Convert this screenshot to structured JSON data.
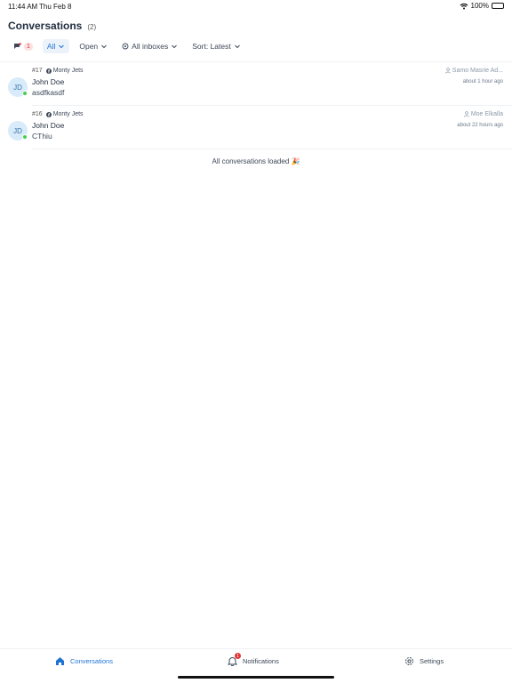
{
  "status_bar": {
    "time": "11:44 AM",
    "date": "Thu Feb 8",
    "battery": "100%"
  },
  "header": {
    "title": "Conversations",
    "count": "(2)"
  },
  "filters": {
    "unread_count": "1",
    "status_filter": "All",
    "conversation_status": "Open",
    "inbox_filter": "All inboxes",
    "sort": "Sort: Latest"
  },
  "conversations": [
    {
      "id": "#17",
      "inbox": "Monty Jets",
      "avatar_initials": "JD",
      "name": "John Doe",
      "message": "asdfkasdf",
      "assignee": "Samo Masrie Ad...",
      "time_ago": "about 1 hour ago"
    },
    {
      "id": "#16",
      "inbox": "Monty Jets",
      "avatar_initials": "JD",
      "name": "John Doe",
      "message": "CThiu",
      "assignee": "Moe Elkalla",
      "time_ago": "about 22 hours ago"
    }
  ],
  "footer_text": "All conversations loaded 🎉",
  "tabbar": {
    "conversations": "Conversations",
    "notifications": "Notifications",
    "notifications_badge": "1",
    "settings": "Settings"
  },
  "colors": {
    "accent": "#1f73d3",
    "online": "#44ce4b",
    "badge": "#e03434"
  }
}
